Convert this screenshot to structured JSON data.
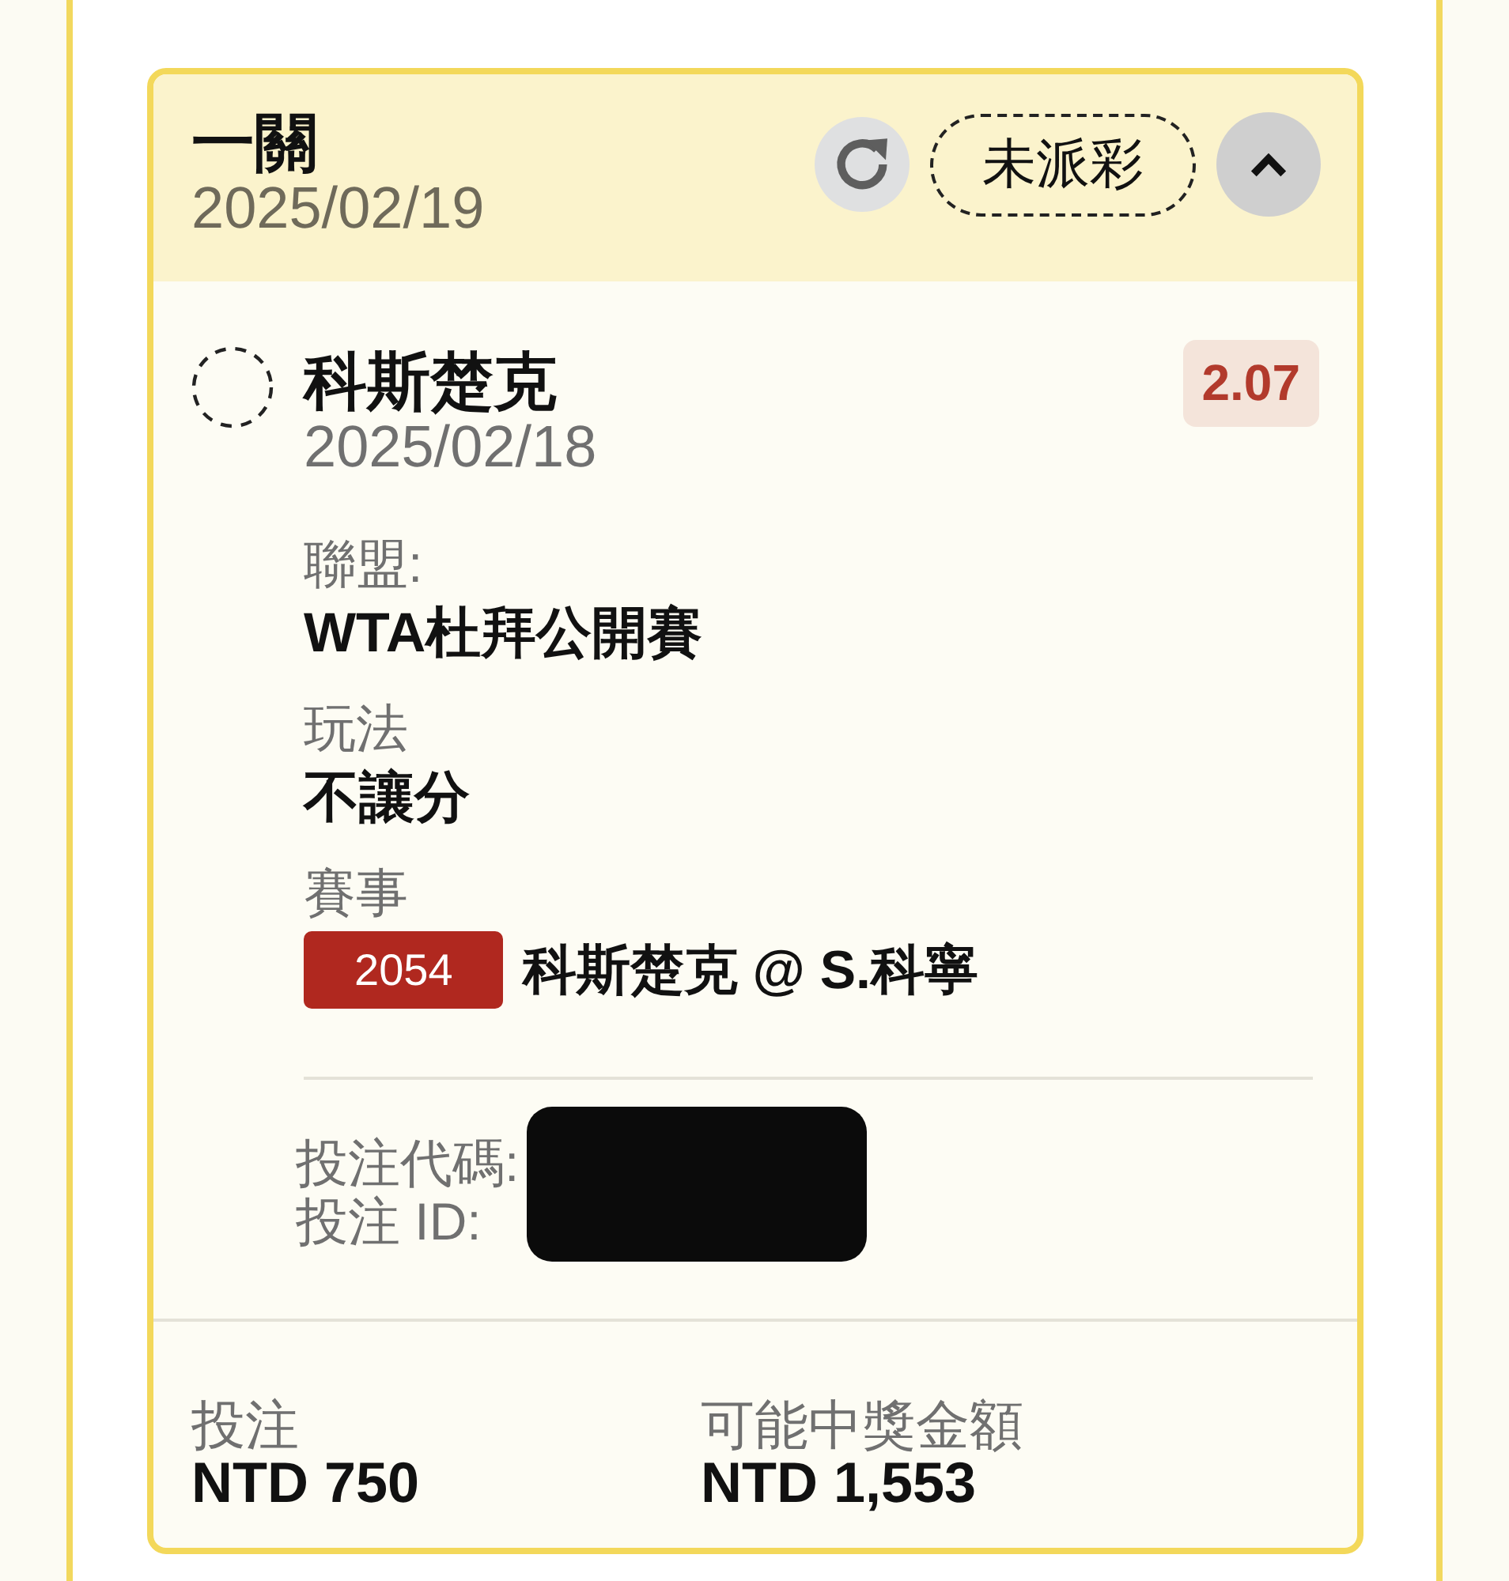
{
  "bet": {
    "type": "一關",
    "date": "2025/02/19",
    "status": "未派彩",
    "expanded": true
  },
  "selection": {
    "settled": false,
    "team": "科斯楚克",
    "date": "2025/02/18",
    "odds": "2.07",
    "details": [
      {
        "kind": "text",
        "label": "聯盟:",
        "value": "WTA杜拜公開賽"
      },
      {
        "kind": "text",
        "label": "玩法",
        "value": "不讓分"
      },
      {
        "kind": "event",
        "label": "賽事",
        "code": "2054",
        "value": "科斯楚克 @ S.科寧"
      }
    ]
  },
  "references": {
    "redacted": true,
    "items": [
      {
        "label": "投注代碼:"
      },
      {
        "label": "投注 ID:"
      }
    ]
  },
  "summary": [
    {
      "label": "投注",
      "value": "NTD 750"
    },
    {
      "label": "可能中獎金額",
      "value": "NTD 1,553"
    }
  ]
}
